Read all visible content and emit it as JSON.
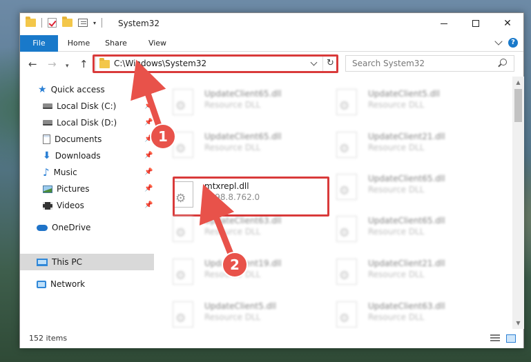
{
  "window": {
    "title": "System32",
    "controls": {
      "minimize": "minimize",
      "maximize": "maximize",
      "close": "✕"
    }
  },
  "ribbon": {
    "tabs": [
      {
        "label": "File"
      },
      {
        "label": "Home"
      },
      {
        "label": "Share"
      },
      {
        "label": "View"
      }
    ],
    "help": "?"
  },
  "navigation": {
    "address": "C:\\Windows\\System32",
    "search_placeholder": "Search System32"
  },
  "sidebar": {
    "items": [
      {
        "label": "Quick access",
        "icon": "star-icon"
      },
      {
        "label": "Local Disk (C:)",
        "icon": "drive-icon",
        "pinned": true
      },
      {
        "label": "Local Disk (D:)",
        "icon": "drive-icon",
        "pinned": true
      },
      {
        "label": "Documents",
        "icon": "document-icon",
        "pinned": true
      },
      {
        "label": "Downloads",
        "icon": "download-icon",
        "pinned": true
      },
      {
        "label": "Music",
        "icon": "music-icon",
        "pinned": true
      },
      {
        "label": "Pictures",
        "icon": "pictures-icon",
        "pinned": true
      },
      {
        "label": "Videos",
        "icon": "videos-icon",
        "pinned": true
      },
      {
        "label": "OneDrive",
        "icon": "cloud-icon"
      },
      {
        "label": "This PC",
        "icon": "computer-icon",
        "selected": true
      },
      {
        "label": "Network",
        "icon": "network-icon"
      }
    ]
  },
  "files": {
    "left": [
      {
        "name": "UpdateClient65.dll",
        "sub": "Resource DLL"
      },
      {
        "name": "UpdateClient65.dll",
        "sub": "Resource DLL"
      },
      {
        "name": "mtxrepl.dll",
        "sub": "1998.8.762.0",
        "highlighted": true
      },
      {
        "name": "UpdateClient63.dll",
        "sub": "Resource DLL"
      },
      {
        "name": "UpdateClient19.dll",
        "sub": "Resource DLL"
      },
      {
        "name": "UpdateClient5.dll",
        "sub": "Resource DLL"
      }
    ],
    "right": [
      {
        "name": "UpdateClient5.dll",
        "sub": "Resource DLL"
      },
      {
        "name": "UpdateClient21.dll",
        "sub": "Resource DLL"
      },
      {
        "name": "UpdateClient65.dll",
        "sub": "Resource DLL"
      },
      {
        "name": "UpdateClient65.dll",
        "sub": "Resource DLL"
      },
      {
        "name": "UpdateClient21.dll",
        "sub": "Resource DLL"
      },
      {
        "name": "UpdateClient63.dll",
        "sub": "Resource DLL"
      }
    ]
  },
  "status": {
    "item_count": "152 items"
  },
  "annotations": [
    {
      "number": "1"
    },
    {
      "number": "2"
    }
  ],
  "colors": {
    "accent": "#1979ca",
    "highlight": "#d93a3a"
  }
}
